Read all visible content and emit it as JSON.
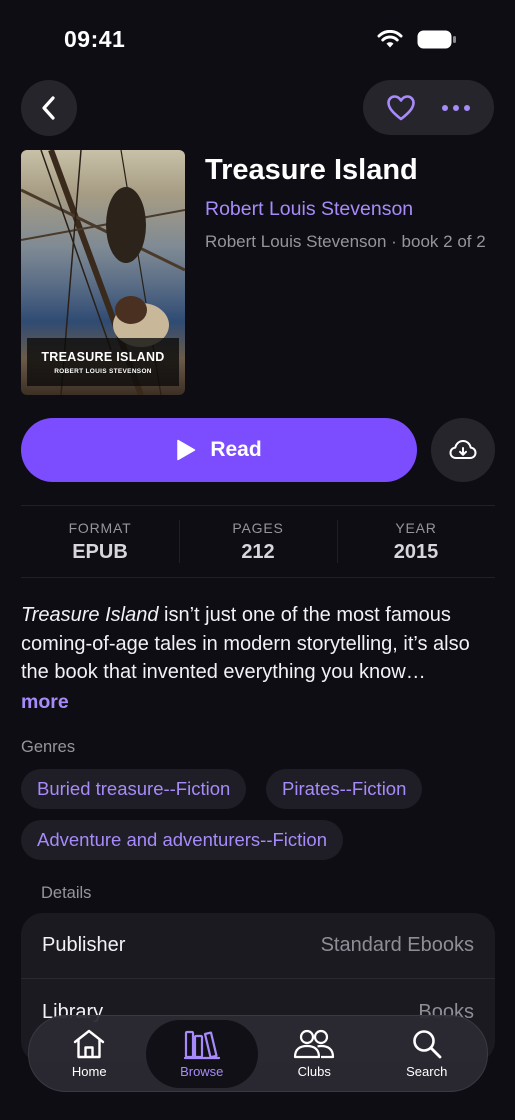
{
  "status_bar": {
    "time": "09:41"
  },
  "book": {
    "title": "Treasure Island",
    "author": "Robert Louis Stevenson",
    "series": "Robert Louis Stevenson · book 2 of 2",
    "cover": {
      "title": "TREASURE ISLAND",
      "author": "ROBERT LOUIS STEVENSON"
    }
  },
  "actions": {
    "read_label": "Read"
  },
  "stats": [
    {
      "label": "FORMAT",
      "value": "EPUB"
    },
    {
      "label": "PAGES",
      "value": "212"
    },
    {
      "label": "YEAR",
      "value": "2015"
    }
  ],
  "description": {
    "italic_lead": "Treasure Island",
    "text": " isn’t just one of the most famous coming-of-age tales in modern storytelling, it’s also the book that invented everything you know…",
    "more_label": "more"
  },
  "genres": {
    "heading": "Genres",
    "items": [
      "Buried treasure--Fiction",
      "Pirates--Fiction",
      "Adventure and adventurers--Fiction"
    ]
  },
  "details": {
    "heading": "Details",
    "rows": [
      {
        "key": "Publisher",
        "value": "Standard Ebooks"
      },
      {
        "key": "Library",
        "value": "Books"
      }
    ]
  },
  "tabbar": {
    "active": "Browse",
    "tabs": [
      {
        "label": "Home",
        "icon": "home-icon"
      },
      {
        "label": "Browse",
        "icon": "books-icon"
      },
      {
        "label": "Clubs",
        "icon": "people-icon"
      },
      {
        "label": "Search",
        "icon": "search-icon"
      }
    ]
  },
  "colors": {
    "accent": "#7c4dff",
    "accent_text": "#a78bfa",
    "background": "#0f0d14"
  }
}
